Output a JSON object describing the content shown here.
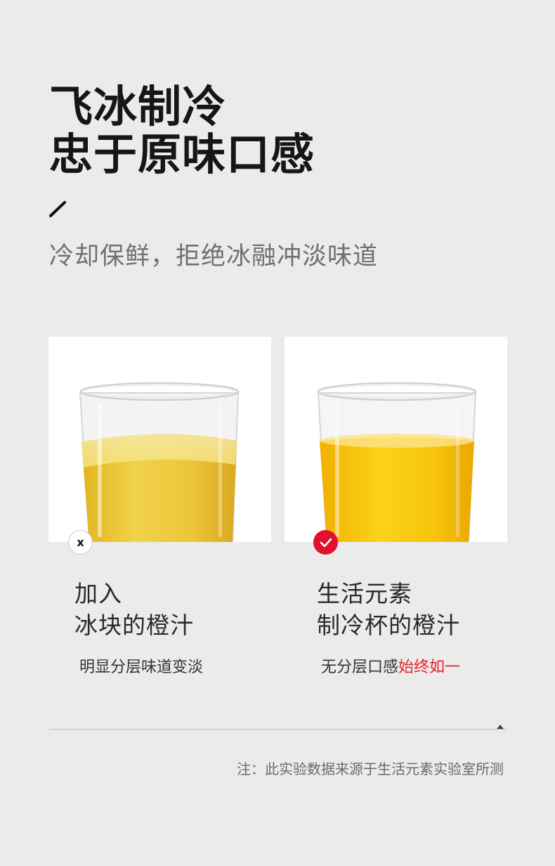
{
  "headline": {
    "line1": "飞冰制冷",
    "line2": "忠于原味口感"
  },
  "subtitle": "冷却保鲜，拒绝冰融冲淡味道",
  "comparison": {
    "left": {
      "mark_icon": "cross-icon",
      "mark_text": "x",
      "heading_line1": "加入",
      "heading_line2": "冰块的橙汁",
      "description": "明显分层味道变淡"
    },
    "right": {
      "mark_icon": "check-icon",
      "heading_line1": "生活元素",
      "heading_line2": "制冷杯的橙汁",
      "description_plain": "无分层口感",
      "description_accent": "始终如一"
    }
  },
  "footnote": "注：此实验数据来源于生活元素实验室所测",
  "colors": {
    "accent": "#e20f2d",
    "accent_text": "#e8202d",
    "background": "#ebebeb"
  }
}
